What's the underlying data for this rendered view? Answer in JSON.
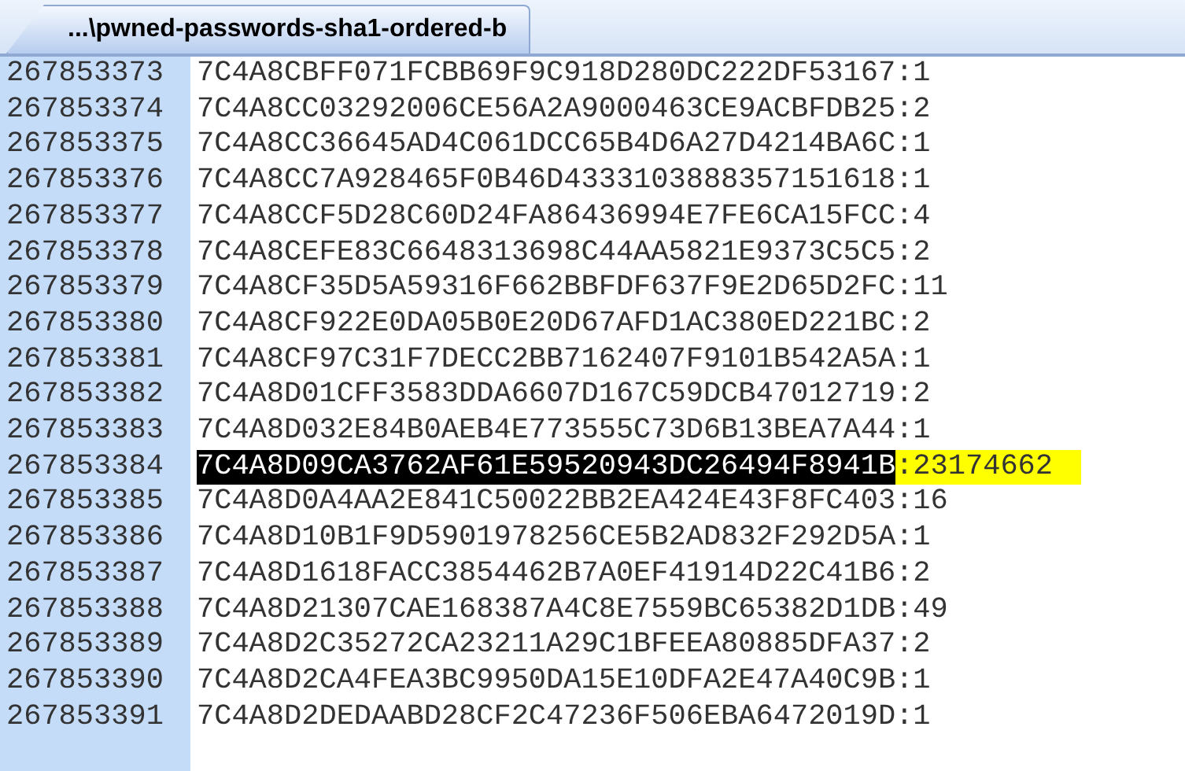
{
  "tabs": [
    {
      "label": "...\\pwned-passwords-sha1-ordered-b",
      "selected": true
    }
  ],
  "lines": [
    {
      "number": "267853373",
      "hash": "7C4A8CBFF071FCBB69F9C918D280DC222DF53167",
      "suffix": ":1",
      "selected": false
    },
    {
      "number": "267853374",
      "hash": "7C4A8CC03292006CE56A2A9000463CE9ACBFDB25",
      "suffix": ":2",
      "selected": false
    },
    {
      "number": "267853375",
      "hash": "7C4A8CC36645AD4C061DCC65B4D6A27D4214BA6C",
      "suffix": ":1",
      "selected": false
    },
    {
      "number": "267853376",
      "hash": "7C4A8CC7A928465F0B46D4333103888357151618",
      "suffix": ":1",
      "selected": false
    },
    {
      "number": "267853377",
      "hash": "7C4A8CCF5D28C60D24FA86436994E7FE6CA15FCC",
      "suffix": ":4",
      "selected": false
    },
    {
      "number": "267853378",
      "hash": "7C4A8CEFE83C6648313698C44AA5821E9373C5C5",
      "suffix": ":2",
      "selected": false
    },
    {
      "number": "267853379",
      "hash": "7C4A8CF35D5A59316F662BBFDF637F9E2D65D2FC",
      "suffix": ":11",
      "selected": false
    },
    {
      "number": "267853380",
      "hash": "7C4A8CF922E0DA05B0E20D67AFD1AC380ED221BC",
      "suffix": ":2",
      "selected": false
    },
    {
      "number": "267853381",
      "hash": "7C4A8CF97C31F7DECC2BB7162407F9101B542A5A",
      "suffix": ":1",
      "selected": false
    },
    {
      "number": "267853382",
      "hash": "7C4A8D01CFF3583DDA6607D167C59DCB47012719",
      "suffix": ":2",
      "selected": false
    },
    {
      "number": "267853383",
      "hash": "7C4A8D032E84B0AEB4E773555C73D6B13BEA7A44",
      "suffix": ":1",
      "selected": false
    },
    {
      "number": "267853384",
      "hash": "7C4A8D09CA3762AF61E59520943DC26494F8941B",
      "suffix": ":23174662",
      "selected": true
    },
    {
      "number": "267853385",
      "hash": "7C4A8D0A4AA2E841C50022BB2EA424E43F8FC403",
      "suffix": ":16",
      "selected": false
    },
    {
      "number": "267853386",
      "hash": "7C4A8D10B1F9D5901978256CE5B2AD832F292D5A",
      "suffix": ":1",
      "selected": false
    },
    {
      "number": "267853387",
      "hash": "7C4A8D1618FACC3854462B7A0EF41914D22C41B6",
      "suffix": ":2",
      "selected": false
    },
    {
      "number": "267853388",
      "hash": "7C4A8D21307CAE168387A4C8E7559BC65382D1DB",
      "suffix": ":49",
      "selected": false
    },
    {
      "number": "267853389",
      "hash": "7C4A8D2C35272CA23211A29C1BFEEA80885DFA37",
      "suffix": ":2",
      "selected": false
    },
    {
      "number": "267853390",
      "hash": "7C4A8D2CA4FEA3BC9950DA15E10DFA2E47A40C9B",
      "suffix": ":1",
      "selected": false
    },
    {
      "number": "267853391",
      "hash": "7C4A8D2DEDAABD28CF2C47236F506EBA6472019D",
      "suffix": ":1",
      "selected": false
    }
  ]
}
